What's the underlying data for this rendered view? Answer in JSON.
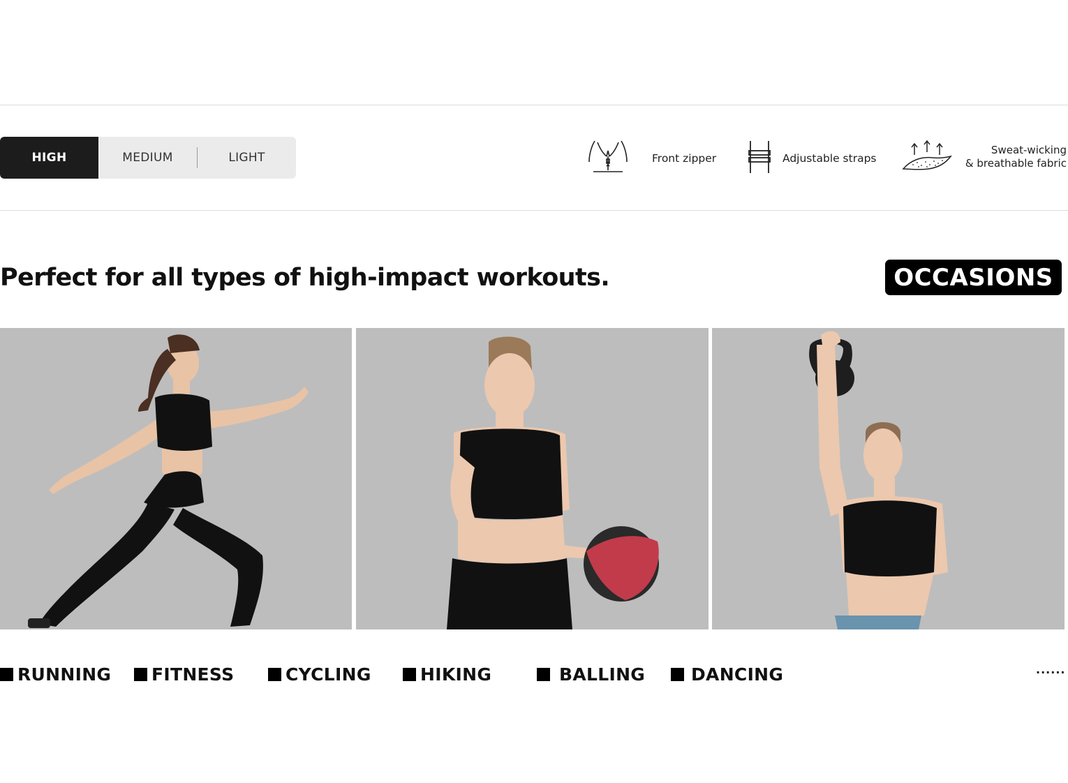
{
  "support_levels": {
    "tabs": [
      {
        "label": "HIGH",
        "active": true
      },
      {
        "label": "MEDIUM",
        "active": false
      },
      {
        "label": "LIGHT",
        "active": false
      }
    ]
  },
  "features": [
    {
      "icon": "front-zipper-icon",
      "label": "Front zipper"
    },
    {
      "icon": "adjustable-straps-icon",
      "label": "Adjustable straps"
    },
    {
      "icon": "sweat-wicking-icon",
      "label_line1": "Sweat-wicking",
      "label_line2": "& breathable fabric"
    }
  ],
  "headline": "Perfect for all types of high-impact workouts.",
  "badge": "OCCASIONS",
  "photos": [
    {
      "name": "running-model-photo"
    },
    {
      "name": "medicine-ball-model-photo"
    },
    {
      "name": "kettlebell-model-photo"
    }
  ],
  "activities": [
    "RUNNING",
    "FITNESS",
    "CYCLING",
    "HIKING",
    "BALLING",
    "DANCING"
  ],
  "more": "......",
  "colors": {
    "active_tab": "#1c1c1c",
    "tab_bar": "#ebebeb",
    "photo_bg": "#bdbdbd",
    "badge_bg": "#000000"
  }
}
